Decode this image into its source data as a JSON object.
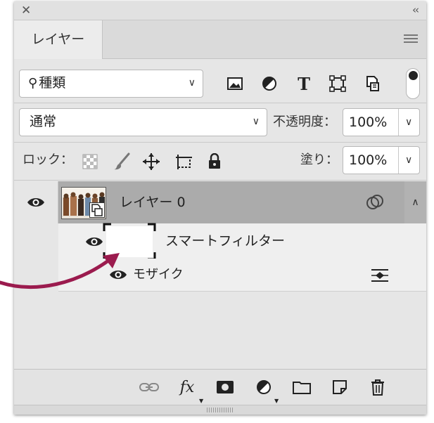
{
  "panel": {
    "close_glyph": "✕",
    "collapse_glyph": "‹‹",
    "tab_label": "レイヤー"
  },
  "filter": {
    "kind_value": "種類",
    "icons": [
      "image-filter-icon",
      "adjustment-filter-icon",
      "type-filter-icon",
      "shape-filter-icon",
      "smart-object-filter-icon"
    ]
  },
  "blend": {
    "mode_value": "通常",
    "opacity_label": "不透明度：",
    "opacity_value": "100%",
    "fill_label": "塗り：",
    "fill_value": "100%"
  },
  "lock": {
    "label": "ロック：",
    "icons": [
      "lock-transparent-pixels-icon",
      "lock-image-pixels-icon",
      "lock-position-icon",
      "lock-artboard-icon",
      "lock-all-icon"
    ]
  },
  "layers": [
    {
      "name": "レイヤー 0",
      "smart_filters_label": "スマートフィルター",
      "filters": [
        {
          "name": "モザイク"
        }
      ]
    }
  ],
  "bottom_bar": {
    "fx_label": "fx",
    "icons": [
      "link-layers-icon",
      "fx-icon",
      "layer-mask-icon",
      "adjustment-layer-icon",
      "new-group-icon",
      "new-layer-icon",
      "delete-icon"
    ]
  },
  "colors": {
    "annotation_arrow": "#9b1b4e",
    "selected_layer": "#ababab"
  }
}
